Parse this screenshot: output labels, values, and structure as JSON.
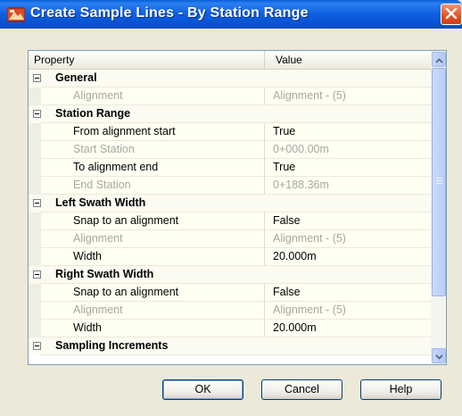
{
  "window": {
    "title": "Create Sample Lines - By Station Range",
    "icon": "civil3d-app-icon",
    "close_icon": "close-icon"
  },
  "grid": {
    "headers": {
      "property": "Property",
      "value": "Value"
    },
    "rows": [
      {
        "type": "category",
        "label": "General",
        "value": ""
      },
      {
        "type": "item",
        "label": "Alignment",
        "value": "Alignment - (5)",
        "disabled": true
      },
      {
        "type": "category",
        "label": "Station Range",
        "value": ""
      },
      {
        "type": "item",
        "label": "From alignment start",
        "value": "True",
        "disabled": false
      },
      {
        "type": "item",
        "label": "Start Station",
        "value": "0+000.00m",
        "disabled": true
      },
      {
        "type": "item",
        "label": "To alignment end",
        "value": "True",
        "disabled": false
      },
      {
        "type": "item",
        "label": "End Station",
        "value": "0+188.36m",
        "disabled": true
      },
      {
        "type": "category",
        "label": "Left Swath Width",
        "value": ""
      },
      {
        "type": "item",
        "label": "Snap to an alignment",
        "value": "False",
        "disabled": false
      },
      {
        "type": "item",
        "label": "Alignment",
        "value": "Alignment - (5)",
        "disabled": true
      },
      {
        "type": "item",
        "label": "Width",
        "value": "20.000m",
        "disabled": false
      },
      {
        "type": "category",
        "label": "Right Swath Width",
        "value": ""
      },
      {
        "type": "item",
        "label": "Snap to an alignment",
        "value": "False",
        "disabled": false
      },
      {
        "type": "item",
        "label": "Alignment",
        "value": "Alignment - (5)",
        "disabled": true
      },
      {
        "type": "item",
        "label": "Width",
        "value": "20.000m",
        "disabled": false
      },
      {
        "type": "category",
        "label": "Sampling Increments",
        "value": ""
      }
    ]
  },
  "buttons": {
    "ok": "OK",
    "cancel": "Cancel",
    "help": "Help"
  },
  "colors": {
    "titlebar": "#0a5fd8",
    "disabled_text": "#a8a8a0",
    "dialog_bg": "#ece9d8"
  }
}
